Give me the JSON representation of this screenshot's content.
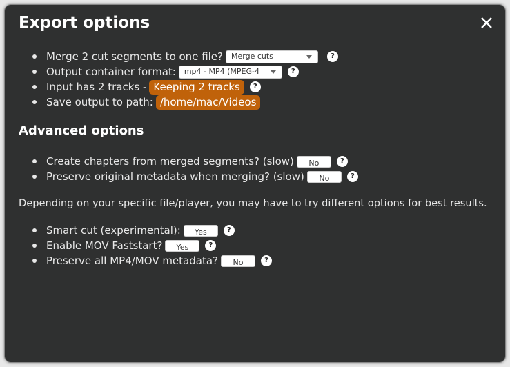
{
  "dialog": {
    "title": "Export options",
    "close_icon": "close-icon",
    "basic": [
      {
        "label": "Merge 2 cut segments to one file?",
        "select": "Merge cuts"
      },
      {
        "label": "Output container format:",
        "select": "mp4 - MP4 (MPEG-4"
      },
      {
        "label": "Input has 2 tracks -",
        "highlight": "Keeping 2 tracks"
      },
      {
        "label": "Save output to path:",
        "highlight": "/home/mac/Videos"
      }
    ],
    "advanced_title": "Advanced options",
    "advanced": [
      {
        "label": "Create chapters from merged segments? (slow)",
        "value": "No"
      },
      {
        "label": "Preserve original metadata when merging? (slow)",
        "value": "No"
      }
    ],
    "note": "Depending on your specific file/player, you may have to try different options for best results.",
    "extra": [
      {
        "label": "Smart cut (experimental):",
        "value": "Yes"
      },
      {
        "label": "Enable MOV Faststart?",
        "value": "Yes"
      },
      {
        "label": "Preserve all MP4/MOV metadata?",
        "value": "No"
      }
    ],
    "help_glyph": "?",
    "accent": "#c0620a"
  }
}
